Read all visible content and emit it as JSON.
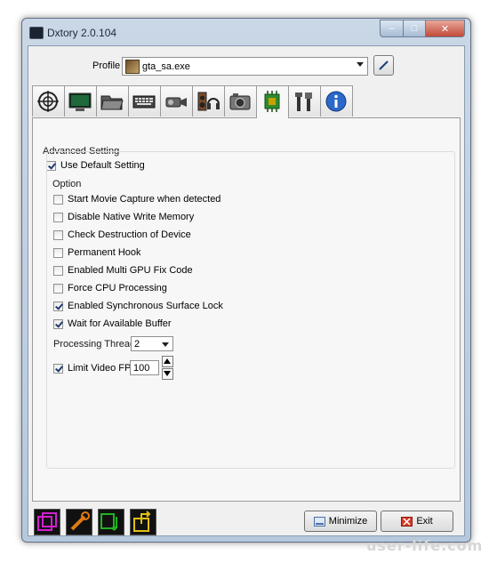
{
  "window": {
    "title": "Dxtory 2.0.104",
    "controls": {
      "minimize": "–",
      "maximize": "□",
      "close": "✕"
    }
  },
  "profile": {
    "label": "Profile",
    "value": "gta_sa.exe"
  },
  "tabs": [
    {
      "name": "crosshair-icon"
    },
    {
      "name": "monitor-icon"
    },
    {
      "name": "folder-icon"
    },
    {
      "name": "keyboard-icon"
    },
    {
      "name": "camcorder-icon"
    },
    {
      "name": "headset-icon"
    },
    {
      "name": "camera-icon"
    },
    {
      "name": "chip-icon"
    },
    {
      "name": "tools-icon"
    },
    {
      "name": "info-icon"
    }
  ],
  "active_tab": 7,
  "advanced": {
    "title": "Advanced Setting",
    "use_default": {
      "label": "Use Default Setting",
      "checked": true
    },
    "option_title": "Option",
    "options": [
      {
        "label": "Start Movie Capture when detected",
        "checked": false
      },
      {
        "label": "Disable Native Write Memory",
        "checked": false
      },
      {
        "label": "Check Destruction of Device",
        "checked": false
      },
      {
        "label": "Permanent Hook",
        "checked": false
      },
      {
        "label": "Enabled Multi GPU Fix Code",
        "checked": false
      },
      {
        "label": "Force CPU Processing",
        "checked": false
      },
      {
        "label": "Enabled Synchronous Surface Lock",
        "checked": true
      },
      {
        "label": "Wait for Available Buffer",
        "checked": true
      }
    ],
    "threads_label": "Processing Threads",
    "threads_value": "2",
    "fps": {
      "label": "Limit Video FPS",
      "checked": true,
      "value": "100"
    }
  },
  "bottom": {
    "minimize_label": "Minimize",
    "exit_label": "Exit"
  },
  "watermark": "user-life.com"
}
